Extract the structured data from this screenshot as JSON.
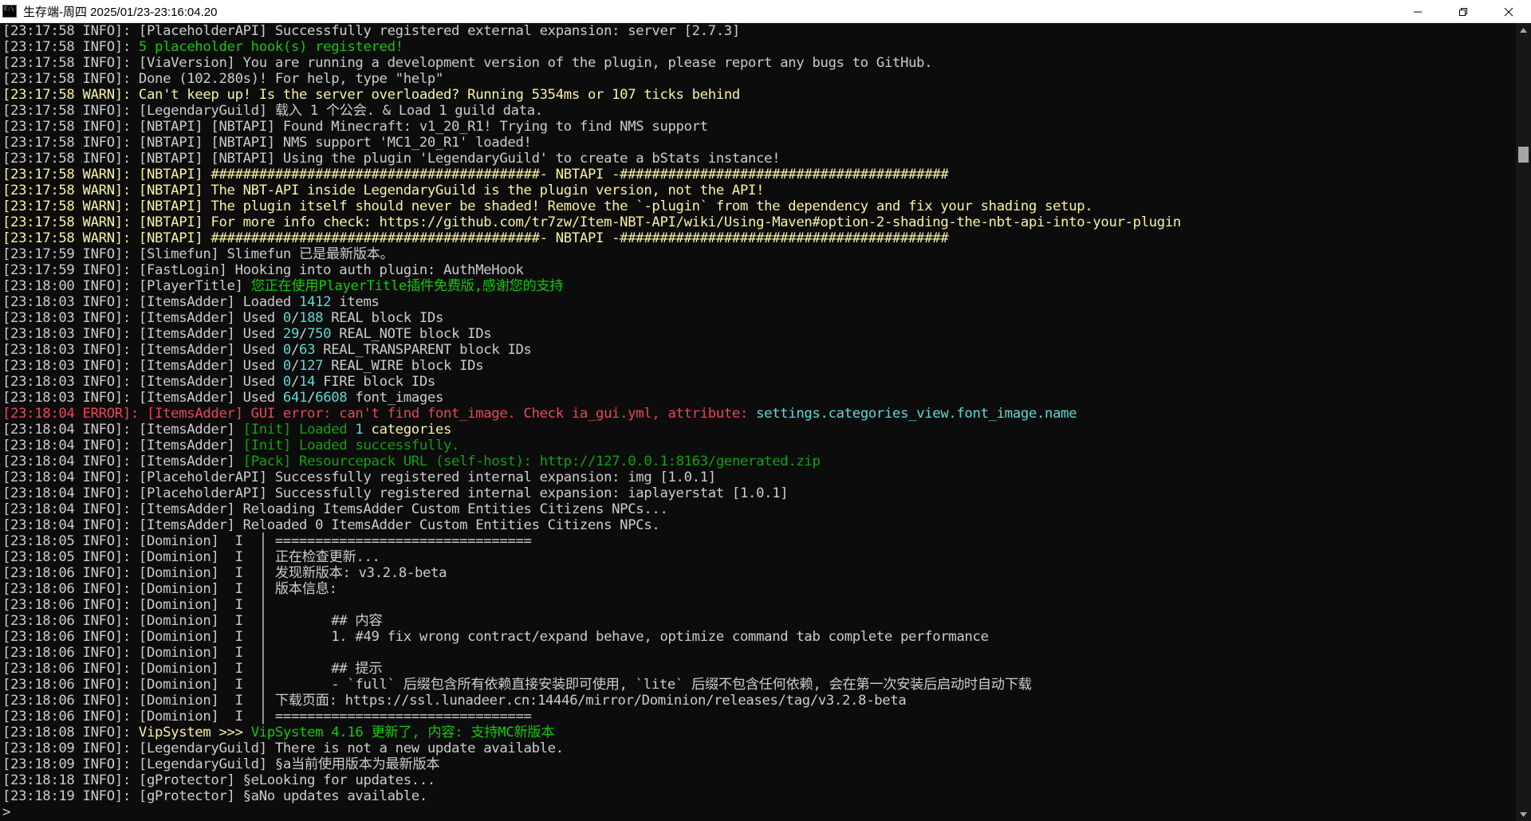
{
  "window": {
    "title": "生存端-周四 2025/01/23-23:16:04.20",
    "minimize_label": "minimize",
    "maximize_label": "restore",
    "close_label": "close"
  },
  "colors": {
    "info": "#cccccc",
    "warn": "#f9f1a5",
    "error": "#e74856",
    "green": "#16c60c",
    "cyan": "#61d6d6"
  },
  "console": {
    "lines": [
      [
        {
          "c": "def",
          "t": "[23:17:58 INFO]: [PlaceholderAPI] Successfully registered external expansion: server [2.7.3]"
        }
      ],
      [
        {
          "c": "def",
          "t": "[23:17:58 INFO]: "
        },
        {
          "c": "green",
          "t": "5 placeholder hook(s) registered!"
        }
      ],
      [
        {
          "c": "def",
          "t": "[23:17:58 INFO]: [ViaVersion] You are running a development version of the plugin, please report any bugs to GitHub."
        }
      ],
      [
        {
          "c": "def",
          "t": "[23:17:58 INFO]: Done (102.280s)! For help, type \"help\""
        }
      ],
      [
        {
          "c": "warn",
          "t": "[23:17:58 WARN]: Can't keep up! Is the server overloaded? Running 5354ms or 107 ticks behind"
        }
      ],
      [
        {
          "c": "def",
          "t": "[23:17:58 INFO]: [LegendaryGuild] 载入 1 个公会. & Load 1 guild data."
        }
      ],
      [
        {
          "c": "def",
          "t": "[23:17:58 INFO]: [NBTAPI] [NBTAPI] Found Minecraft: v1_20_R1! Trying to find NMS support"
        }
      ],
      [
        {
          "c": "def",
          "t": "[23:17:58 INFO]: [NBTAPI] [NBTAPI] NMS support 'MC1_20_R1' loaded!"
        }
      ],
      [
        {
          "c": "def",
          "t": "[23:17:58 INFO]: [NBTAPI] [NBTAPI] Using the plugin 'LegendaryGuild' to create a bStats instance!"
        }
      ],
      [
        {
          "c": "warn",
          "t": "[23:17:58 WARN]: [NBTAPI] #########################################- NBTAPI -#########################################"
        }
      ],
      [
        {
          "c": "warn",
          "t": "[23:17:58 WARN]: [NBTAPI] The NBT-API inside LegendaryGuild is the plugin version, not the API!"
        }
      ],
      [
        {
          "c": "warn",
          "t": "[23:17:58 WARN]: [NBTAPI] The plugin itself should never be shaded! Remove the `-plugin` from the dependency and fix your shading setup."
        }
      ],
      [
        {
          "c": "warn",
          "t": "[23:17:58 WARN]: [NBTAPI] For more info check: https://github.com/tr7zw/Item-NBT-API/wiki/Using-Maven#option-2-shading-the-nbt-api-into-your-plugin"
        }
      ],
      [
        {
          "c": "warn",
          "t": "[23:17:58 WARN]: [NBTAPI] #########################################- NBTAPI -#########################################"
        }
      ],
      [
        {
          "c": "def",
          "t": "[23:17:59 INFO]: [Slimefun] Slimefun 已是最新版本。"
        }
      ],
      [
        {
          "c": "def",
          "t": "[23:17:59 INFO]: [FastLogin] Hooking into auth plugin: AuthMeHook"
        }
      ],
      [
        {
          "c": "def",
          "t": "[23:18:00 INFO]: [PlayerTitle] "
        },
        {
          "c": "green",
          "t": "您正在使用PlayerTitle插件免费版,感谢您的支持"
        }
      ],
      [
        {
          "c": "def",
          "t": "[23:18:03 INFO]: [ItemsAdder] Loaded "
        },
        {
          "c": "cyan",
          "t": "1412"
        },
        {
          "c": "def",
          "t": " items"
        }
      ],
      [
        {
          "c": "def",
          "t": "[23:18:03 INFO]: [ItemsAdder] Used "
        },
        {
          "c": "cyan",
          "t": "0"
        },
        {
          "c": "def",
          "t": "/"
        },
        {
          "c": "cyan",
          "t": "188"
        },
        {
          "c": "def",
          "t": " REAL block IDs"
        }
      ],
      [
        {
          "c": "def",
          "t": "[23:18:03 INFO]: [ItemsAdder] Used "
        },
        {
          "c": "cyan",
          "t": "29"
        },
        {
          "c": "def",
          "t": "/"
        },
        {
          "c": "cyan",
          "t": "750"
        },
        {
          "c": "def",
          "t": " REAL_NOTE block IDs"
        }
      ],
      [
        {
          "c": "def",
          "t": "[23:18:03 INFO]: [ItemsAdder] Used "
        },
        {
          "c": "cyan",
          "t": "0"
        },
        {
          "c": "def",
          "t": "/"
        },
        {
          "c": "cyan",
          "t": "63"
        },
        {
          "c": "def",
          "t": " REAL_TRANSPARENT block IDs"
        }
      ],
      [
        {
          "c": "def",
          "t": "[23:18:03 INFO]: [ItemsAdder] Used "
        },
        {
          "c": "cyan",
          "t": "0"
        },
        {
          "c": "def",
          "t": "/"
        },
        {
          "c": "cyan",
          "t": "127"
        },
        {
          "c": "def",
          "t": " REAL_WIRE block IDs"
        }
      ],
      [
        {
          "c": "def",
          "t": "[23:18:03 INFO]: [ItemsAdder] Used "
        },
        {
          "c": "cyan",
          "t": "0"
        },
        {
          "c": "def",
          "t": "/"
        },
        {
          "c": "cyan",
          "t": "14"
        },
        {
          "c": "def",
          "t": " FIRE block IDs"
        }
      ],
      [
        {
          "c": "def",
          "t": "[23:18:03 INFO]: [ItemsAdder] Used "
        },
        {
          "c": "cyan",
          "t": "641"
        },
        {
          "c": "def",
          "t": "/"
        },
        {
          "c": "cyan",
          "t": "6608"
        },
        {
          "c": "def",
          "t": " font_images"
        }
      ],
      [
        {
          "c": "err",
          "t": "[23:18:04 ERROR]: [ItemsAdder] GUI error: can't find font_image. Check ia_gui.yml, attribute: "
        },
        {
          "c": "cyan",
          "t": "settings.categories_view.font_image.name"
        }
      ],
      [
        {
          "c": "def",
          "t": "[23:18:04 INFO]: [ItemsAdder] "
        },
        {
          "c": "ltgreen",
          "t": "[Init] Loaded "
        },
        {
          "c": "cyan",
          "t": "1"
        },
        {
          "c": "warn",
          "t": " categories"
        }
      ],
      [
        {
          "c": "def",
          "t": "[23:18:04 INFO]: [ItemsAdder] "
        },
        {
          "c": "ltgreen",
          "t": "[Init] Loaded successfully."
        }
      ],
      [
        {
          "c": "def",
          "t": "[23:18:04 INFO]: [ItemsAdder] "
        },
        {
          "c": "ltgreen",
          "t": "[Pack] Resourcepack URL (self-host): http://127.0.0.1:8163/generated.zip"
        }
      ],
      [
        {
          "c": "def",
          "t": "[23:18:04 INFO]: [PlaceholderAPI] Successfully registered internal expansion: img [1.0.1]"
        }
      ],
      [
        {
          "c": "def",
          "t": "[23:18:04 INFO]: [PlaceholderAPI] Successfully registered internal expansion: iaplayerstat [1.0.1]"
        }
      ],
      [
        {
          "c": "def",
          "t": "[23:18:04 INFO]: [ItemsAdder] Reloading ItemsAdder Custom Entities Citizens NPCs..."
        }
      ],
      [
        {
          "c": "def",
          "t": "[23:18:04 INFO]: [ItemsAdder] Reloaded 0 ItemsAdder Custom Entities Citizens NPCs."
        }
      ],
      [
        {
          "c": "def",
          "t": "[23:18:05 INFO]: [Dominion]  I  │ ================================"
        }
      ],
      [
        {
          "c": "def",
          "t": "[23:18:05 INFO]: [Dominion]  I  │ 正在检查更新..."
        }
      ],
      [
        {
          "c": "def",
          "t": "[23:18:06 INFO]: [Dominion]  I  │ 发现新版本: v3.2.8-beta"
        }
      ],
      [
        {
          "c": "def",
          "t": "[23:18:06 INFO]: [Dominion]  I  │ 版本信息:"
        }
      ],
      [
        {
          "c": "def",
          "t": "[23:18:06 INFO]: [Dominion]  I  │"
        }
      ],
      [
        {
          "c": "def",
          "t": "[23:18:06 INFO]: [Dominion]  I  │        ## 内容"
        }
      ],
      [
        {
          "c": "def",
          "t": "[23:18:06 INFO]: [Dominion]  I  │        1. #49 fix wrong contract/expand behave, optimize command tab complete performance"
        }
      ],
      [
        {
          "c": "def",
          "t": "[23:18:06 INFO]: [Dominion]  I  │"
        }
      ],
      [
        {
          "c": "def",
          "t": "[23:18:06 INFO]: [Dominion]  I  │        ## 提示"
        }
      ],
      [
        {
          "c": "def",
          "t": "[23:18:06 INFO]: [Dominion]  I  │        - `full` 后缀包含所有依赖直接安装即可使用, `lite` 后缀不包含任何依赖, 会在第一次安装后启动时自动下载"
        }
      ],
      [
        {
          "c": "def",
          "t": "[23:18:06 INFO]: [Dominion]  I  │ 下载页面: https://ssl.lunadeer.cn:14446/mirror/Dominion/releases/tag/v3.2.8-beta"
        }
      ],
      [
        {
          "c": "def",
          "t": "[23:18:06 INFO]: [Dominion]  I  │ ================================"
        }
      ],
      [
        {
          "c": "def",
          "t": "[23:18:08 INFO]: "
        },
        {
          "c": "warn",
          "t": "VipSystem >>> "
        },
        {
          "c": "green",
          "t": "VipSystem 4.16 更新了, 内容: 支持MC新版本"
        }
      ],
      [
        {
          "c": "def",
          "t": "[23:18:09 INFO]: [LegendaryGuild] There is not a new update available."
        }
      ],
      [
        {
          "c": "def",
          "t": "[23:18:09 INFO]: [LegendaryGuild] §a当前使用版本为最新版本"
        }
      ],
      [
        {
          "c": "def",
          "t": "[23:18:18 INFO]: [gProtector] §eLooking for updates..."
        }
      ],
      [
        {
          "c": "def",
          "t": "[23:18:19 INFO]: [gProtector] §aNo updates available."
        }
      ],
      [
        {
          "c": "def",
          "t": ">"
        }
      ]
    ]
  }
}
